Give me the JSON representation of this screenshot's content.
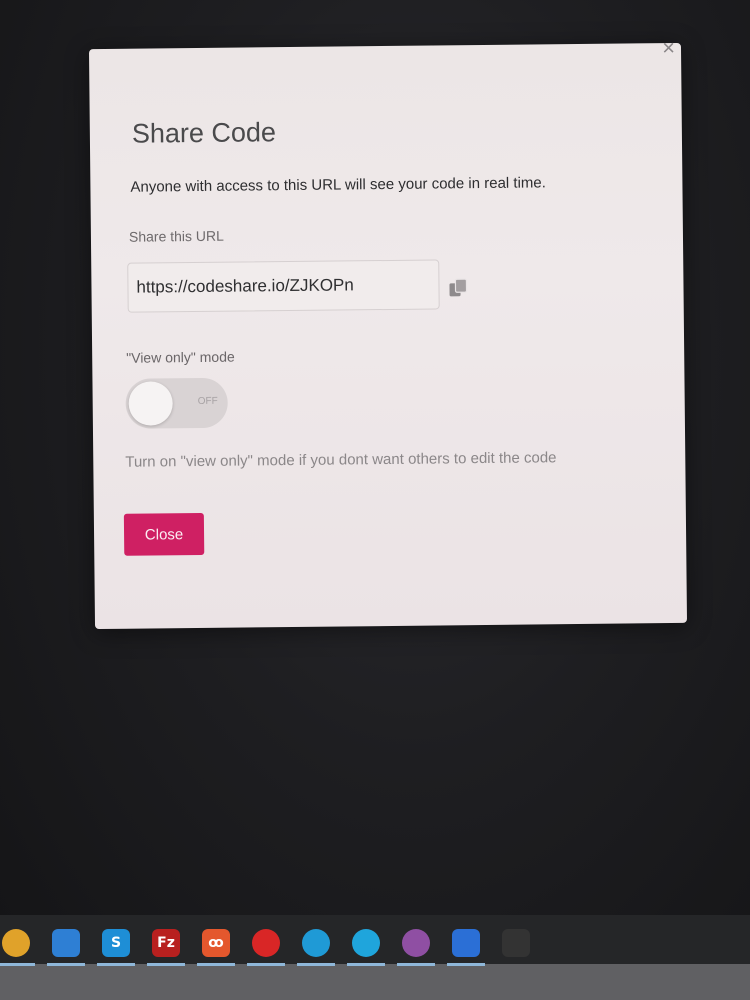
{
  "modal": {
    "title": "Share Code",
    "close_symbol": "×",
    "description": "Anyone with access to this URL will see your code in real time.",
    "share_label": "Share this URL",
    "url_value": "https://codeshare.io/ZJKOPn",
    "copy_icon": "copy-icon",
    "view_only_label": "\"View only\" mode",
    "toggle_state": "OFF",
    "hint": "Turn on \"view only\" mode if you dont want others to edit the code",
    "close_button": "Close",
    "accent_color": "#cf2063"
  },
  "taskbar": {
    "icons": [
      {
        "name": "chrome-icon",
        "glyph": "",
        "color": "#e0a22a"
      },
      {
        "name": "vscode-icon",
        "glyph": "",
        "color": "#2e7fd4"
      },
      {
        "name": "skype-icon",
        "glyph": "S",
        "color": "#1e8ed6"
      },
      {
        "name": "filezilla-icon",
        "glyph": "Fz",
        "color": "#b8201f"
      },
      {
        "name": "xampp-icon",
        "glyph": "ꝏ",
        "color": "#e4572d"
      },
      {
        "name": "red-app-icon",
        "glyph": "",
        "color": "#d92626"
      },
      {
        "name": "edge-icon",
        "glyph": "",
        "color": "#1f9ad6"
      },
      {
        "name": "blue-app-icon",
        "glyph": "",
        "color": "#1fa5dc"
      },
      {
        "name": "github-desktop-icon",
        "glyph": "",
        "color": "#8f4fa3"
      },
      {
        "name": "teamviewer-icon",
        "glyph": "",
        "color": "#2b6fd6"
      },
      {
        "name": "terminal-icon",
        "glyph": "",
        "color": "#333333"
      }
    ]
  }
}
